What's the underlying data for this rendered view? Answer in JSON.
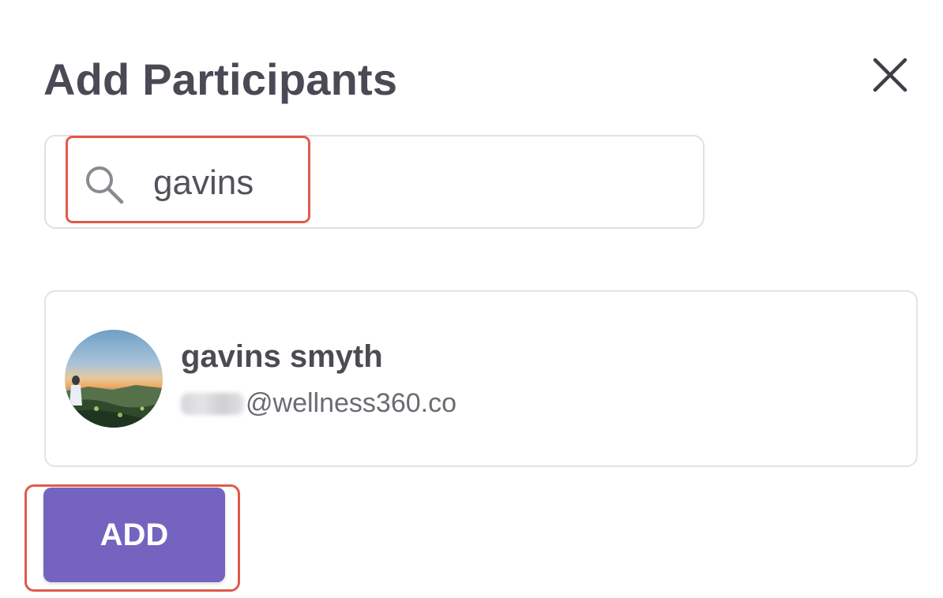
{
  "dialog": {
    "title": "Add Participants",
    "close_icon": "close-icon"
  },
  "search": {
    "icon": "search-icon",
    "value": "gavins",
    "placeholder": ""
  },
  "results": [
    {
      "name": "gavins smyth",
      "email_visible": "@wellness360.co",
      "email_redacted": true,
      "avatar": "avatar-photo"
    }
  ],
  "actions": {
    "add_label": "ADD"
  },
  "colors": {
    "title": "#4a4a55",
    "primary_button": "#7464c0",
    "highlight_border": "#e05a4a",
    "card_border": "#e3e3e6"
  }
}
